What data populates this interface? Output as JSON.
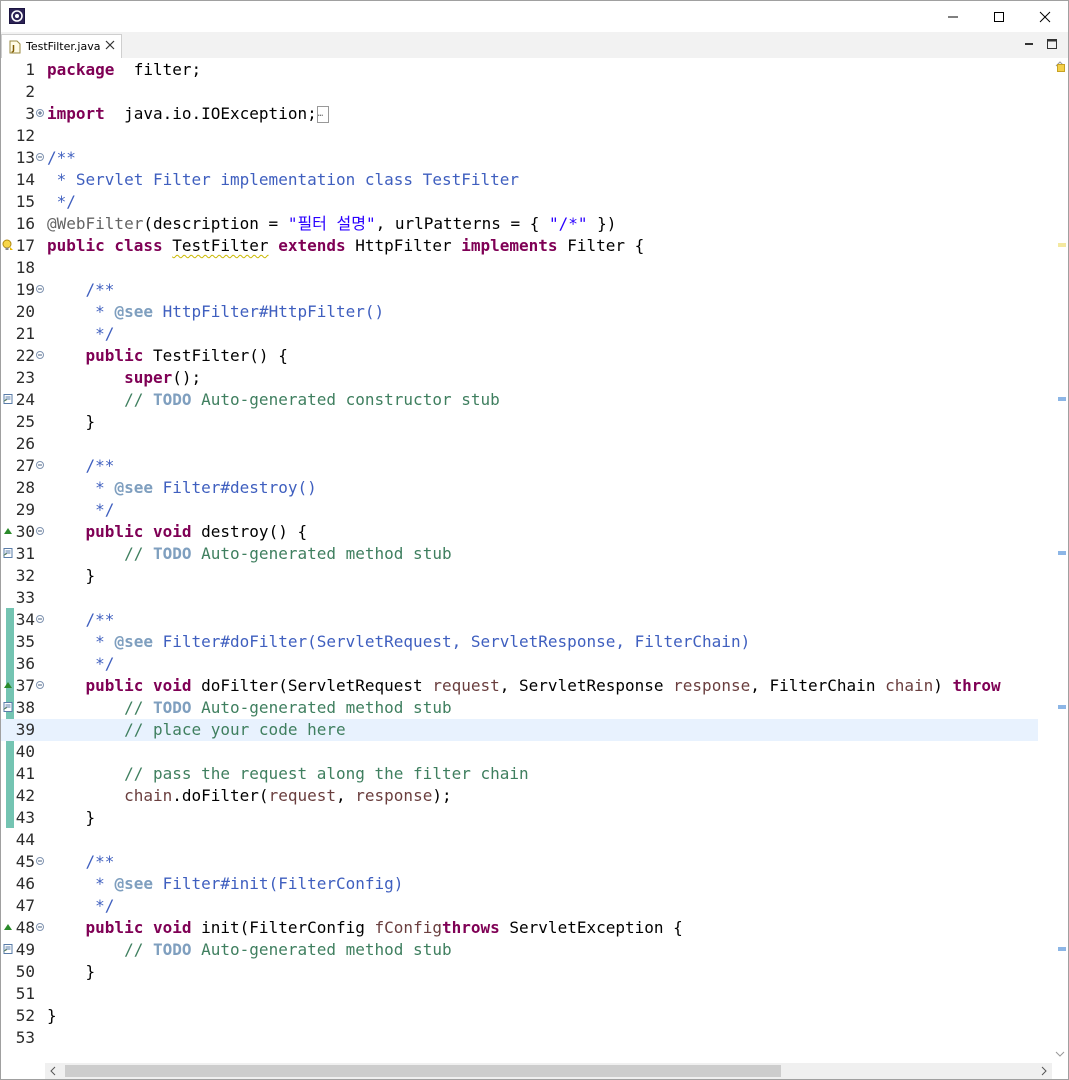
{
  "window": {
    "minimize_label": "─",
    "maximize_label": "□",
    "close_label": "✕"
  },
  "tab": {
    "title": "TestFilter.java"
  },
  "colors": {
    "keyword": "#7f0055",
    "comment": "#3f7f5f",
    "javadoc": "#3f5fbf",
    "string": "#2a00ff",
    "current_line": "#e8f2fe",
    "change_bar": "#74c4b2"
  },
  "lines": [
    {
      "n": "1",
      "tokens": [
        [
          "kw",
          "package"
        ],
        [
          "",
          "  filter;"
        ]
      ]
    },
    {
      "n": "2",
      "tokens": []
    },
    {
      "n": "3",
      "fold": "plus",
      "tokens": [
        [
          "kw",
          "import"
        ],
        [
          "",
          "  java.io.IOException;"
        ],
        [
          "box",
          "…"
        ]
      ]
    },
    {
      "n": "12",
      "tokens": []
    },
    {
      "n": "13",
      "fold": "minus",
      "tokens": [
        [
          "jd",
          "/**"
        ]
      ]
    },
    {
      "n": "14",
      "tokens": [
        [
          "jd",
          " * Servlet Filter implementation class TestFilter"
        ]
      ]
    },
    {
      "n": "15",
      "tokens": [
        [
          "jd",
          " */"
        ]
      ]
    },
    {
      "n": "16",
      "tokens": [
        [
          "ann",
          "@WebFilter"
        ],
        [
          "",
          "(description = "
        ],
        [
          "str",
          "\"필터 설명\""
        ],
        [
          "",
          ", urlPatterns = { "
        ],
        [
          "str",
          "\"/*\""
        ],
        [
          "",
          " })"
        ]
      ]
    },
    {
      "n": "17",
      "marker": "warn",
      "tokens": [
        [
          "kw",
          "public"
        ],
        [
          "",
          ""
        ],
        [
          "kw",
          " class"
        ],
        [
          "",
          " "
        ],
        [
          "squig",
          "TestFilter"
        ],
        [
          "",
          " "
        ],
        [
          "kw",
          "extends"
        ],
        [
          "",
          " HttpFilter "
        ],
        [
          "kw",
          "implements"
        ],
        [
          "",
          " Filter {"
        ]
      ]
    },
    {
      "n": "18",
      "tokens": []
    },
    {
      "n": "19",
      "fold": "minus",
      "tokens": [
        [
          "",
          "    "
        ],
        [
          "jd",
          "/**"
        ]
      ]
    },
    {
      "n": "20",
      "tokens": [
        [
          "",
          "    "
        ],
        [
          "jd",
          " * "
        ],
        [
          "tag",
          "@see"
        ],
        [
          "jd",
          " HttpFilter#HttpFilter()"
        ]
      ]
    },
    {
      "n": "21",
      "tokens": [
        [
          "",
          "    "
        ],
        [
          "jd",
          " */"
        ]
      ]
    },
    {
      "n": "22",
      "fold": "minus",
      "tokens": [
        [
          "",
          "    "
        ],
        [
          "kw",
          "public"
        ],
        [
          "",
          " TestFilter() {"
        ]
      ]
    },
    {
      "n": "23",
      "tokens": [
        [
          "",
          "        "
        ],
        [
          "kw",
          "super"
        ],
        [
          "",
          "();"
        ]
      ]
    },
    {
      "n": "24",
      "marker": "task",
      "tokens": [
        [
          "",
          "        "
        ],
        [
          "cm",
          "// "
        ],
        [
          "todo",
          "TODO"
        ],
        [
          "cm",
          " Auto-generated constructor stub"
        ]
      ]
    },
    {
      "n": "25",
      "tokens": [
        [
          "",
          "    }"
        ]
      ]
    },
    {
      "n": "26",
      "tokens": []
    },
    {
      "n": "27",
      "fold": "minus",
      "tokens": [
        [
          "",
          "    "
        ],
        [
          "jd",
          "/**"
        ]
      ]
    },
    {
      "n": "28",
      "tokens": [
        [
          "",
          "    "
        ],
        [
          "jd",
          " * "
        ],
        [
          "tag",
          "@see"
        ],
        [
          "jd",
          " Filter#destroy()"
        ]
      ]
    },
    {
      "n": "29",
      "tokens": [
        [
          "",
          "    "
        ],
        [
          "jd",
          " */"
        ]
      ]
    },
    {
      "n": "30",
      "fold": "minus",
      "marker": "override",
      "tokens": [
        [
          "",
          "    "
        ],
        [
          "kw",
          "public"
        ],
        [
          "",
          " "
        ],
        [
          "kw",
          "void"
        ],
        [
          "",
          " destroy() {"
        ]
      ]
    },
    {
      "n": "31",
      "marker": "task",
      "tokens": [
        [
          "",
          "        "
        ],
        [
          "cm",
          "// "
        ],
        [
          "todo",
          "TODO"
        ],
        [
          "cm",
          " Auto-generated method stub"
        ]
      ]
    },
    {
      "n": "32",
      "tokens": [
        [
          "",
          "    }"
        ]
      ]
    },
    {
      "n": "33",
      "tokens": []
    },
    {
      "n": "34",
      "fold": "minus",
      "tokens": [
        [
          "",
          "    "
        ],
        [
          "jd",
          "/**"
        ]
      ]
    },
    {
      "n": "35",
      "tokens": [
        [
          "",
          "    "
        ],
        [
          "jd",
          " * "
        ],
        [
          "tag",
          "@see"
        ],
        [
          "jd",
          " Filter#doFilter(ServletRequest, ServletResponse, FilterChain)"
        ]
      ]
    },
    {
      "n": "36",
      "tokens": [
        [
          "",
          "    "
        ],
        [
          "jd",
          " */"
        ]
      ]
    },
    {
      "n": "37",
      "fold": "minus",
      "marker": "override",
      "tokens": [
        [
          "",
          "    "
        ],
        [
          "kw",
          "public"
        ],
        [
          "",
          " "
        ],
        [
          "kw",
          "void"
        ],
        [
          "",
          " doFilter(ServletRequest "
        ],
        [
          "param",
          "request"
        ],
        [
          "",
          ", ServletResponse "
        ],
        [
          "param",
          "response"
        ],
        [
          "",
          ", FilterChain "
        ],
        [
          "param",
          "chain"
        ],
        [
          "",
          ") "
        ],
        [
          "kw",
          "throw"
        ]
      ]
    },
    {
      "n": "38",
      "marker": "task",
      "tokens": [
        [
          "",
          "        "
        ],
        [
          "cm",
          "// "
        ],
        [
          "todo",
          "TODO"
        ],
        [
          "cm",
          " Auto-generated method stub"
        ]
      ]
    },
    {
      "n": "39",
      "current": true,
      "tokens": [
        [
          "",
          "        "
        ],
        [
          "cm",
          "// place your code here"
        ]
      ]
    },
    {
      "n": "40",
      "tokens": []
    },
    {
      "n": "41",
      "tokens": [
        [
          "",
          "        "
        ],
        [
          "cm",
          "// pass the request along the filter chain"
        ]
      ]
    },
    {
      "n": "42",
      "tokens": [
        [
          "",
          "        "
        ],
        [
          "param",
          "chain"
        ],
        [
          "",
          ".doFilter("
        ],
        [
          "param",
          "request"
        ],
        [
          "",
          ", "
        ],
        [
          "param",
          "response"
        ],
        [
          "",
          ");"
        ]
      ]
    },
    {
      "n": "43",
      "tokens": [
        [
          "",
          "    }"
        ]
      ]
    },
    {
      "n": "44",
      "tokens": []
    },
    {
      "n": "45",
      "fold": "minus",
      "tokens": [
        [
          "",
          "    "
        ],
        [
          "jd",
          "/**"
        ]
      ]
    },
    {
      "n": "46",
      "tokens": [
        [
          "",
          "    "
        ],
        [
          "jd",
          " * "
        ],
        [
          "tag",
          "@see"
        ],
        [
          "jd",
          " Filter#init(FilterConfig)"
        ]
      ]
    },
    {
      "n": "47",
      "tokens": [
        [
          "",
          "    "
        ],
        [
          "jd",
          " */"
        ]
      ]
    },
    {
      "n": "48",
      "fold": "minus",
      "marker": "override",
      "tokens": [
        [
          "",
          "    "
        ],
        [
          "kw",
          "public"
        ],
        [
          "",
          " "
        ],
        [
          "kw",
          "void"
        ],
        [
          "",
          " init(FilterConfig "
        ],
        [
          "param",
          "fConfig"
        ],
        [
          ") "
        ],
        [
          "kw",
          "throws"
        ],
        [
          "",
          " ServletException {"
        ]
      ]
    },
    {
      "n": "49",
      "marker": "task",
      "tokens": [
        [
          "",
          "        "
        ],
        [
          "cm",
          "// "
        ],
        [
          "todo",
          "TODO"
        ],
        [
          "cm",
          " Auto-generated method stub"
        ]
      ]
    },
    {
      "n": "50",
      "tokens": [
        [
          "",
          "    }"
        ]
      ]
    },
    {
      "n": "51",
      "tokens": []
    },
    {
      "n": "52",
      "tokens": [
        [
          "",
          "}"
        ]
      ]
    },
    {
      "n": "53",
      "tokens": []
    }
  ]
}
